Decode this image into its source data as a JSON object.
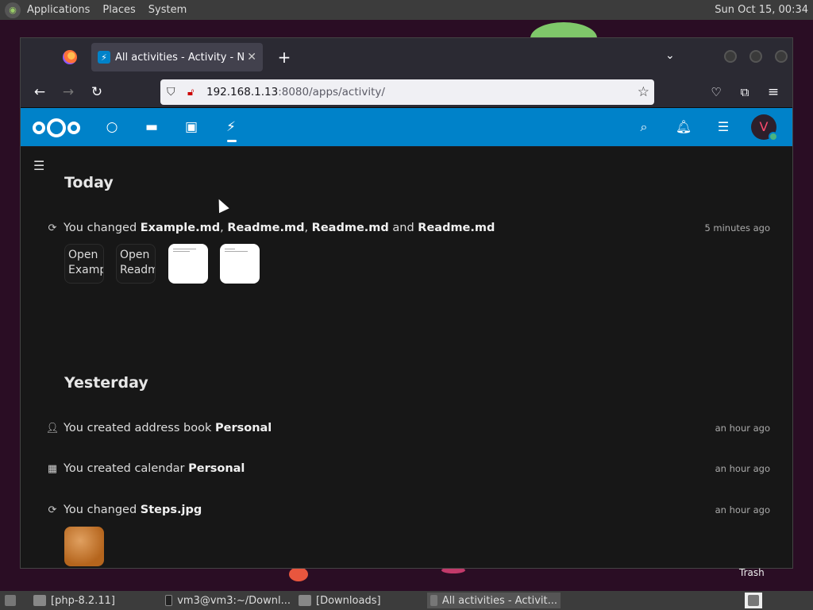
{
  "top_panel": {
    "menus": [
      "Applications",
      "Places",
      "System"
    ],
    "clock": "Sun Oct 15, 00:34"
  },
  "browser": {
    "tab_title": "All activities - Activity - Nextcloud",
    "url_host": "192.168.1.13",
    "url_rest": ":8080/apps/activity/"
  },
  "nextcloud": {
    "avatar_letter": "V"
  },
  "activity": {
    "today_heading": "Today",
    "yesterday_heading": "Yesterday",
    "items": [
      {
        "prefix": "You changed ",
        "files": [
          "Example.md",
          "Readme.md",
          "Readme.md",
          "Readme.md"
        ],
        "time": "5 minutes ago"
      },
      {
        "prefix": "You created address book ",
        "bold": "Personal",
        "time": "an hour ago"
      },
      {
        "prefix": "You created calendar ",
        "bold": "Personal",
        "time": "an hour ago"
      },
      {
        "prefix": "You changed ",
        "bold": "Steps.jpg",
        "time": "an hour ago"
      }
    ],
    "previews": [
      {
        "line1": "Open",
        "line2": "Example.md"
      },
      {
        "line1": "Open",
        "line2": "Readme.md"
      }
    ]
  },
  "desktop": {
    "trash_label": "Trash"
  },
  "taskbar": {
    "tasks": [
      "[php-8.2.11]",
      "vm3@vm3:~/Downl...",
      "[Downloads]",
      "All activities - Activit..."
    ]
  }
}
